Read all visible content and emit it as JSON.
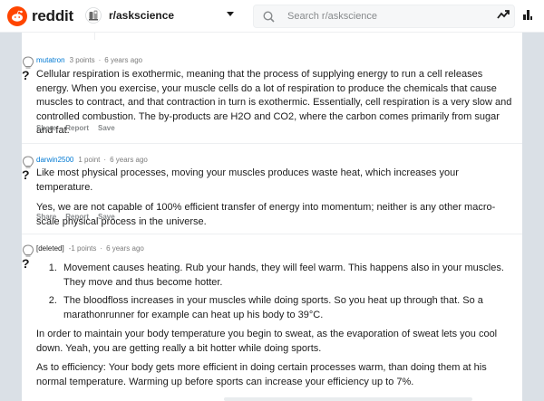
{
  "app": {
    "brand": "reddit",
    "brand_color": "#ff4500"
  },
  "header": {
    "community": "r/askscience",
    "search_placeholder": "Search r/askscience",
    "icons": [
      "reddit-logo-icon",
      "community-icon",
      "chevron-down-icon",
      "search-icon",
      "trending-icon",
      "stats-icon"
    ]
  },
  "comments": [
    {
      "author": "mutatron",
      "points": "3 points",
      "age": "6 years ago",
      "paragraphs": [
        "Cellular respiration is exothermic, meaning that the process of supplying energy to run a cell releases energy. When you exercise, your muscle cells do a lot of respiration to produce the chemicals that cause muscles to contract, and that contraction in turn is exothermic. Essentially, cell respiration is a very slow and controlled combustion. The by-products are H2O and CO2, where the carbon comes primarily from sugar and fat."
      ]
    },
    {
      "author": "darwin2500",
      "points": "1 point",
      "age": "6 years ago",
      "paragraphs": [
        "Like most physical processes, moving your muscles produces waste heat, which increases your temperature.",
        "Yes, we are not capable of 100% efficient transfer of energy into momentum; neither is any other macro-scale physical process in the universe."
      ]
    },
    {
      "author": "[deleted]",
      "points": "-1 points",
      "age": "6 years ago",
      "list": [
        "Movement causes heating. Rub your hands, they will feel warm. This happens also in your muscles. They move and thus become hotter.",
        "The bloodfloss increases in your muscles while doing sports. So you heat up through that. So a marathonrunner for example can heat up his body to 39°C."
      ],
      "paragraphs": [
        "In order to maintain your body temperature you begin to sweat, as the evaporation of sweat lets you cool down. Yeah, you are getting really a bit hotter while doing sports.",
        "As to efficiency: Your body gets more efficient in doing certain processes warm, than doing them at his normal temperature. Warming up before sports can increase your efficiency up to 7%."
      ]
    }
  ],
  "actions": {
    "share": "Share",
    "report": "Report",
    "save": "Save"
  },
  "separator": "·"
}
